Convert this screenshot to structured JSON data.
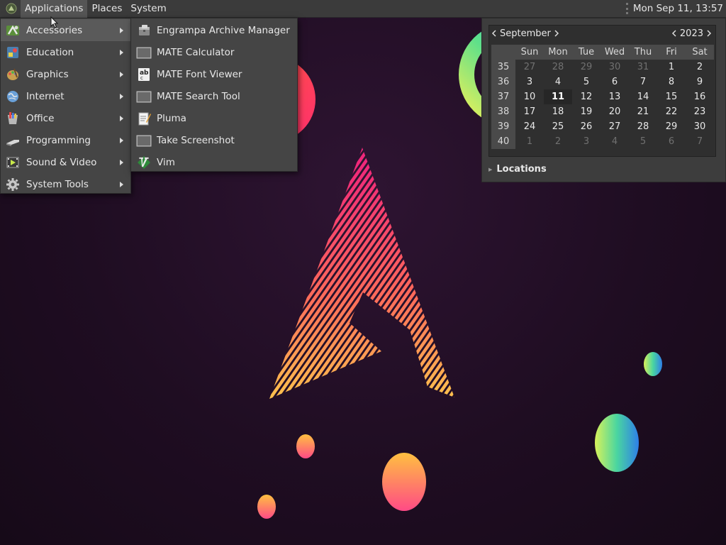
{
  "panel": {
    "menus": [
      "Applications",
      "Places",
      "System"
    ],
    "clock": "Mon Sep 11, 13:57"
  },
  "app_menu": {
    "categories": [
      {
        "label": "Accessories",
        "icon": "accessories-icon"
      },
      {
        "label": "Education",
        "icon": "education-icon"
      },
      {
        "label": "Graphics",
        "icon": "graphics-icon"
      },
      {
        "label": "Internet",
        "icon": "internet-icon"
      },
      {
        "label": "Office",
        "icon": "office-icon"
      },
      {
        "label": "Programming",
        "icon": "programming-icon"
      },
      {
        "label": "Sound & Video",
        "icon": "sound-video-icon"
      },
      {
        "label": "System Tools",
        "icon": "system-tools-icon"
      }
    ],
    "selected": "Accessories"
  },
  "accessories_menu": {
    "items": [
      {
        "label": "Engrampa Archive Manager",
        "icon": "archive-manager-icon"
      },
      {
        "label": "MATE Calculator",
        "icon": "calculator-icon"
      },
      {
        "label": "MATE Font Viewer",
        "icon": "font-viewer-icon"
      },
      {
        "label": "MATE Search Tool",
        "icon": "search-tool-icon"
      },
      {
        "label": "Pluma",
        "icon": "text-editor-icon"
      },
      {
        "label": "Take Screenshot",
        "icon": "screenshot-icon"
      },
      {
        "label": "Vim",
        "icon": "vim-icon"
      }
    ]
  },
  "calendar": {
    "month": "September",
    "year": "2023",
    "weekdays": [
      "Sun",
      "Mon",
      "Tue",
      "Wed",
      "Thu",
      "Fri",
      "Sat"
    ],
    "weeks": [
      {
        "num": "35",
        "days": [
          "27",
          "28",
          "29",
          "30",
          "31",
          "1",
          "2"
        ]
      },
      {
        "num": "36",
        "days": [
          "3",
          "4",
          "5",
          "6",
          "7",
          "8",
          "9"
        ]
      },
      {
        "num": "37",
        "days": [
          "10",
          "11",
          "12",
          "13",
          "14",
          "15",
          "16"
        ]
      },
      {
        "num": "38",
        "days": [
          "17",
          "18",
          "19",
          "20",
          "21",
          "22",
          "23"
        ]
      },
      {
        "num": "39",
        "days": [
          "24",
          "25",
          "26",
          "27",
          "28",
          "29",
          "30"
        ]
      },
      {
        "num": "40",
        "days": [
          "1",
          "2",
          "3",
          "4",
          "5",
          "6",
          "7"
        ]
      }
    ],
    "today": "11",
    "locations_label": "Locations"
  },
  "colors": {
    "panel_bg": "#3b3b3b",
    "menu_bg": "#454545",
    "menu_highlight": "#5a5a5a",
    "desktop_bg": "#1f0d22",
    "logo_pink": "#e8207a",
    "logo_yellow": "#f5c93a"
  }
}
